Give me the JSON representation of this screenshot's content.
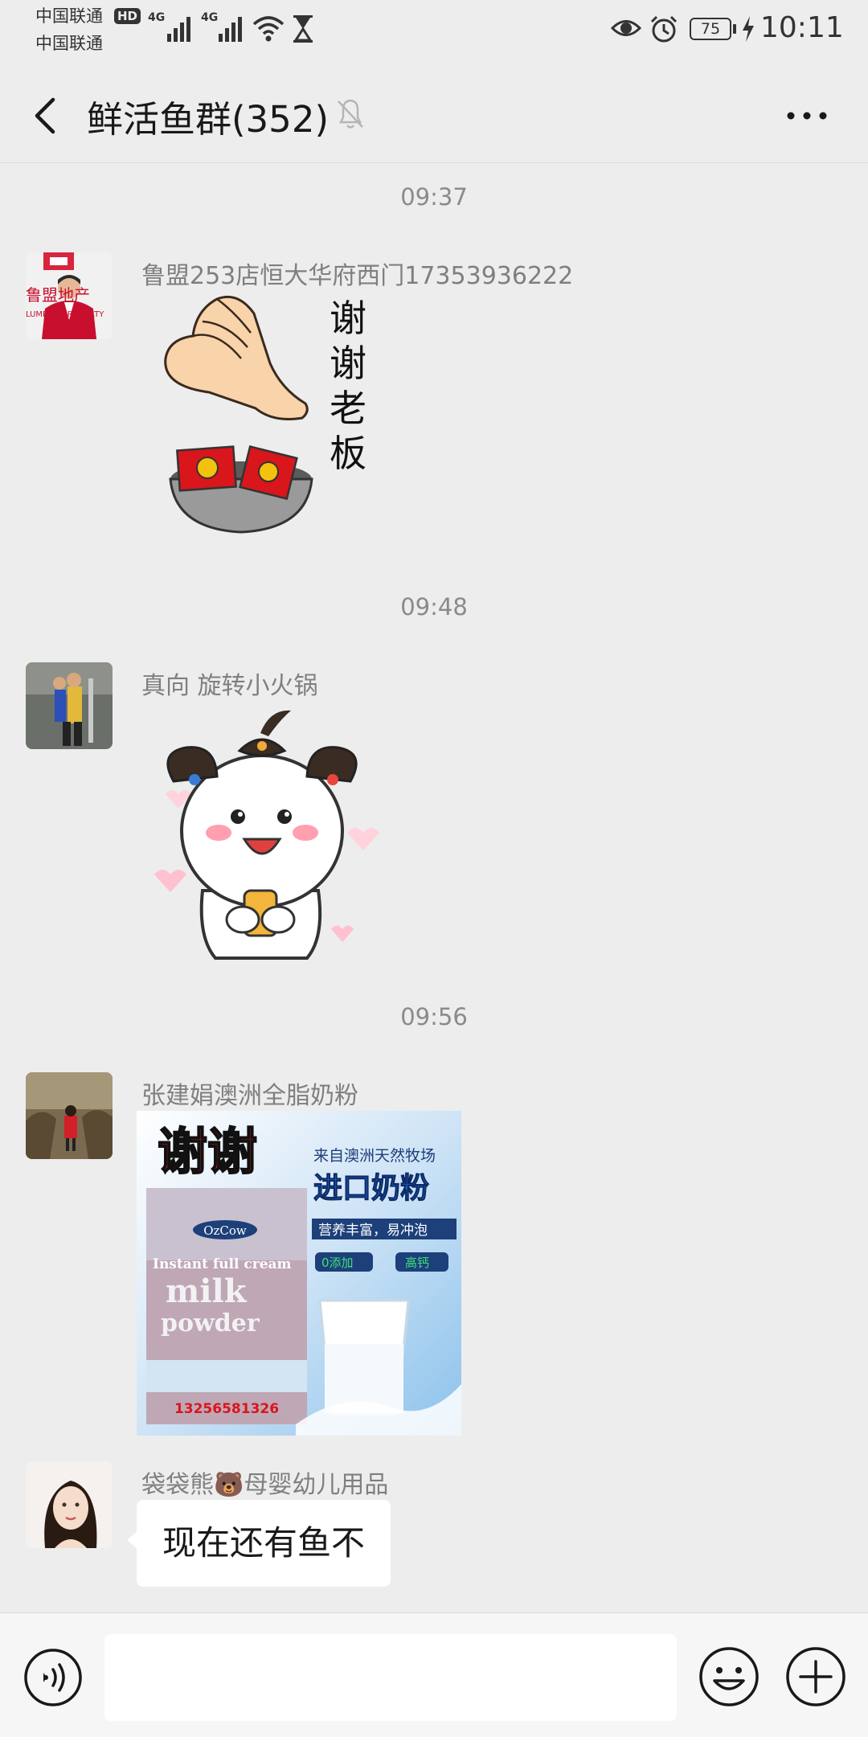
{
  "status_bar": {
    "carrier_1": "中国联通",
    "carrier_2": "中国联通",
    "hd_badge": "HD",
    "network_1": "4G",
    "network_2": "4G",
    "battery": "75",
    "time": "10:11"
  },
  "header": {
    "title": "鲜活鱼群(352)"
  },
  "messages": [
    {
      "time": "09:37",
      "sender": "鲁盟253店恒大华府西门17353936222",
      "avatar_text": "鲁盟地产",
      "avatar_subtext": "LUMENG PROPERTY",
      "sticker_text": [
        "谢",
        "谢",
        "老",
        "板"
      ]
    },
    {
      "time": "09:48",
      "sender": "真向 旋转小火锅"
    },
    {
      "time": "09:56",
      "sender": "张建娟澳洲全脂奶粉",
      "image": {
        "headline": "谢谢",
        "source": "来自澳洲天然牧场",
        "title": "进口奶粉",
        "tagline": "营养丰富，易冲泡",
        "tag_1": "0添加",
        "tag_2": "高钙",
        "brand": "OzCow",
        "product_line_1": "Instant full cream",
        "product_line_2": "milk",
        "product_line_3": "powder",
        "phone": "13256581326"
      }
    },
    {
      "sender": "袋袋熊🐻母婴幼儿用品",
      "text": "现在还有鱼不"
    }
  ],
  "colors": {
    "background": "#ededed",
    "bubble": "#ffffff",
    "meta_text": "#8a8a8a"
  }
}
